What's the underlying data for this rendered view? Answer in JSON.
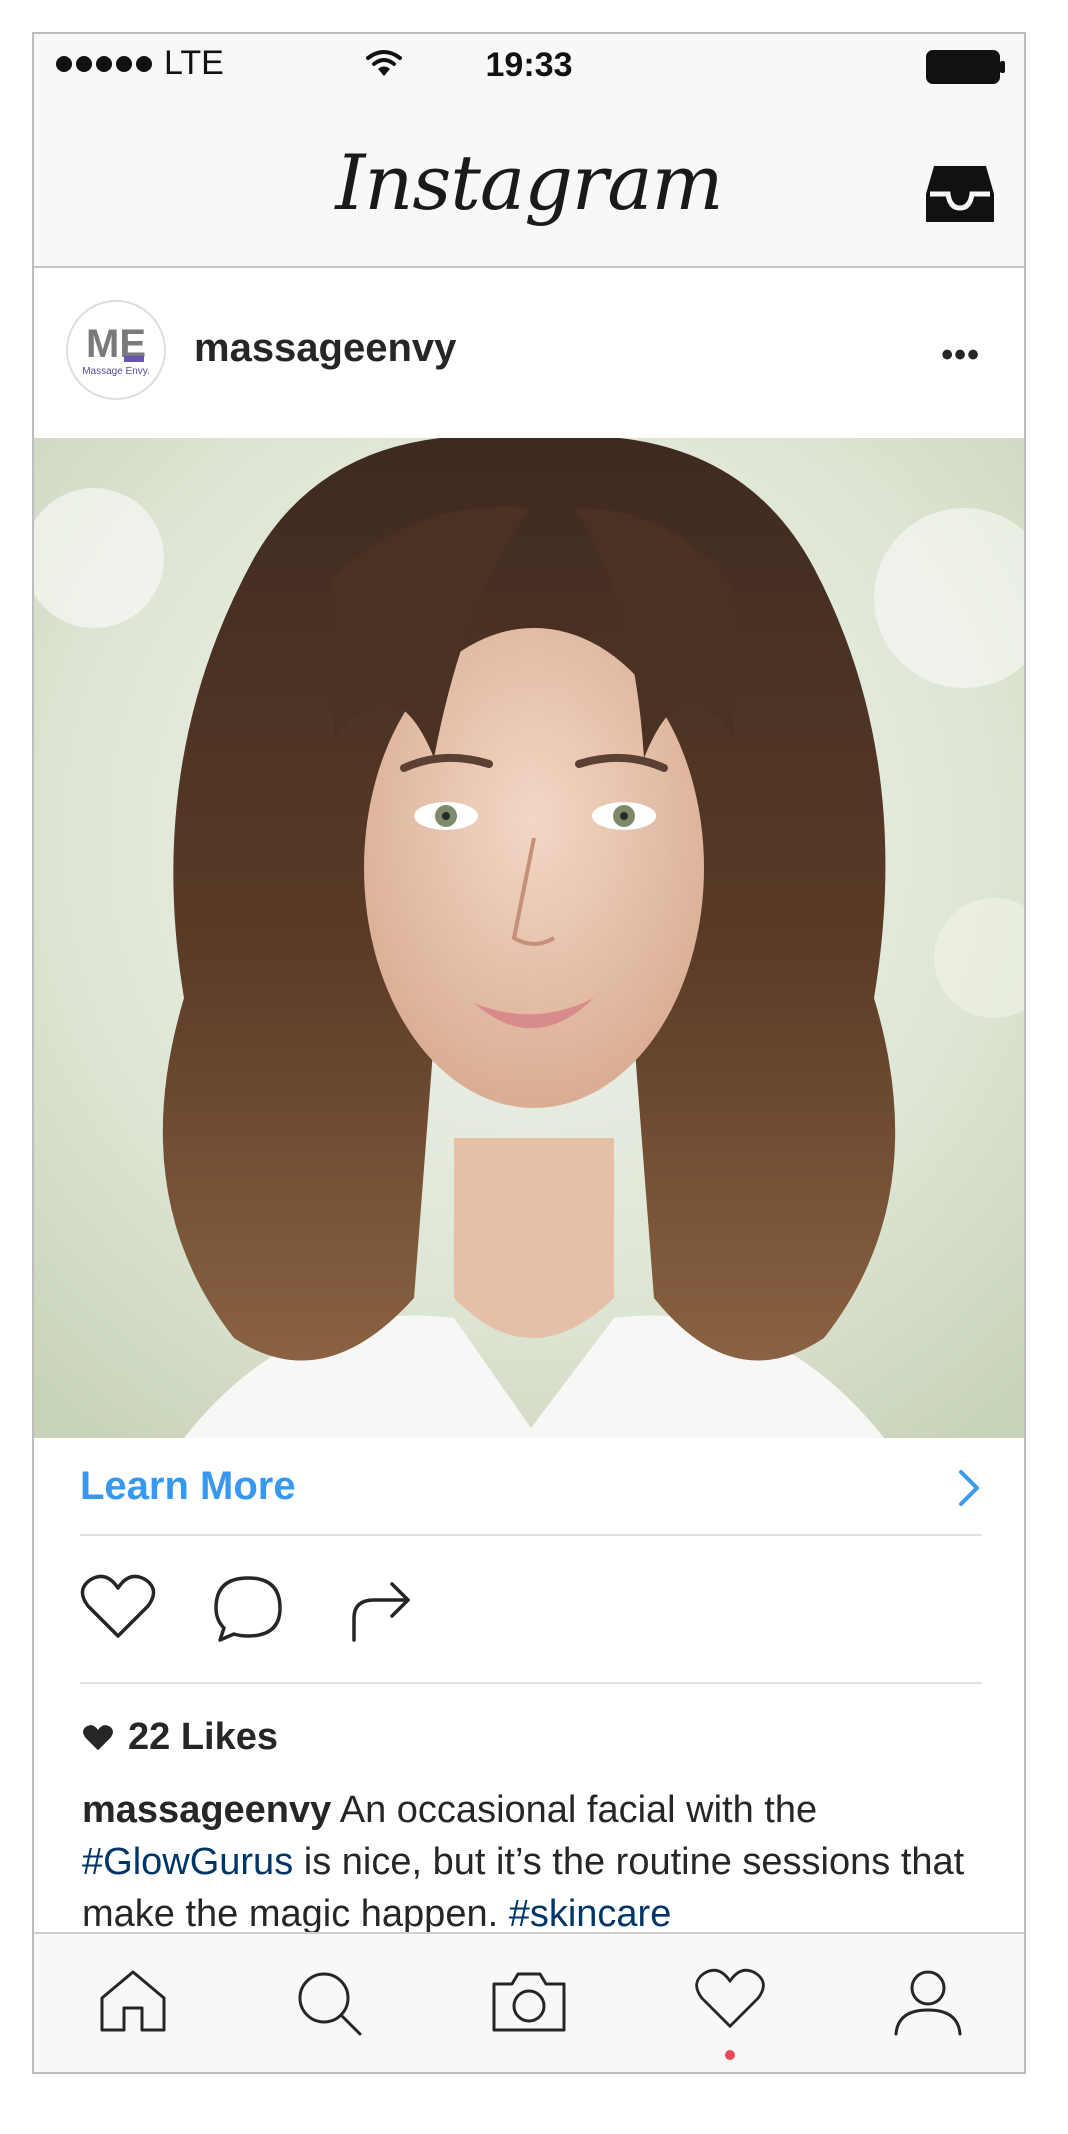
{
  "status_bar": {
    "carrier": "LTE",
    "signal_bars": 5,
    "time": "19:33"
  },
  "nav": {
    "logo_text": "Instagram",
    "inbox_icon": "inbox-tray-icon"
  },
  "post": {
    "avatar": {
      "monogram": "ME",
      "brand": "Massage Envy."
    },
    "username": "massageenvy",
    "more_icon": "more-horizontal-icon",
    "photo_icon": "portrait-photo",
    "cta_label": "Learn More",
    "cta_icon": "chevron-right-icon",
    "actions": [
      "heart-outline-icon",
      "comment-bubble-icon",
      "share-arrow-icon"
    ],
    "likes_text": "22 Likes",
    "caption": {
      "username": "massageenvy",
      "text_1": " An occasional facial with the ",
      "hashtag_1": "#GlowGurus",
      "text_2": " is nice, but it’s the routine sessions that make the magic happen. ",
      "hashtag_2": "#skincare"
    }
  },
  "tab_bar": {
    "tabs": [
      "home-icon",
      "search-icon",
      "camera-icon",
      "activity-heart-icon",
      "profile-icon"
    ],
    "active_notification_tab": "activity-heart-icon"
  },
  "colors": {
    "link_blue": "#3897f0",
    "hashtag_blue": "#003569",
    "notification_red": "#ed4956",
    "avatar_accent": "#6b53b3"
  }
}
